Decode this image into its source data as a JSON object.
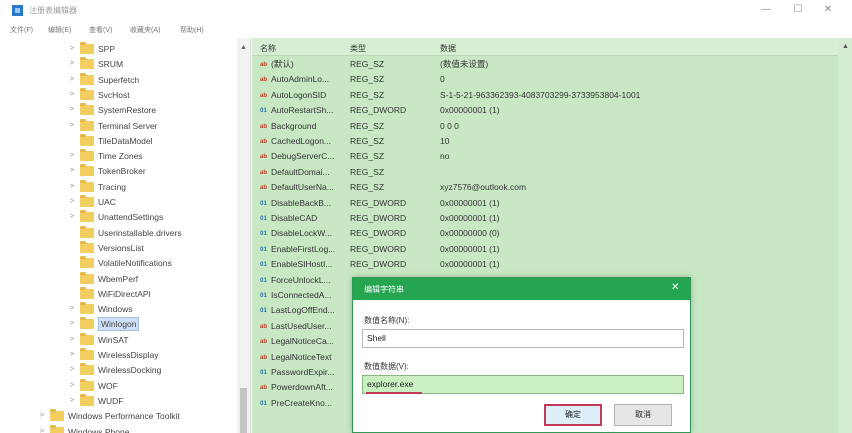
{
  "window": {
    "title": "注册表编辑器",
    "controls": {
      "minimize": "—",
      "maximize": "☐",
      "close": "✕"
    }
  },
  "menu": [
    "文件(F)",
    "编辑(E)",
    "查看(V)",
    "收藏夹(A)",
    "帮助(H)"
  ],
  "tree": {
    "items": [
      {
        "label": "SPP",
        "expandable": true
      },
      {
        "label": "SRUM",
        "expandable": true
      },
      {
        "label": "Superfetch",
        "expandable": true
      },
      {
        "label": "SvcHost",
        "expandable": true
      },
      {
        "label": "SystemRestore",
        "expandable": true
      },
      {
        "label": "Terminal Server",
        "expandable": true
      },
      {
        "label": "TileDataModel",
        "expandable": false
      },
      {
        "label": "Time Zones",
        "expandable": true
      },
      {
        "label": "TokenBroker",
        "expandable": true
      },
      {
        "label": "Tracing",
        "expandable": true
      },
      {
        "label": "UAC",
        "expandable": true
      },
      {
        "label": "UnattendSettings",
        "expandable": true
      },
      {
        "label": "Userinstallable.drivers",
        "expandable": false
      },
      {
        "label": "VersionsList",
        "expandable": false
      },
      {
        "label": "VolatileNotifications",
        "expandable": false
      },
      {
        "label": "WbemPerf",
        "expandable": false
      },
      {
        "label": "WiFiDirectAPI",
        "expandable": false
      },
      {
        "label": "Windows",
        "expandable": true
      },
      {
        "label": "Winlogon",
        "expandable": true,
        "selected": true
      },
      {
        "label": "WinSAT",
        "expandable": true
      },
      {
        "label": "WirelessDisplay",
        "expandable": true
      },
      {
        "label": "WirelessDocking",
        "expandable": true
      },
      {
        "label": "WOF",
        "expandable": true
      },
      {
        "label": "WUDF",
        "expandable": true
      },
      {
        "label": "Windows Performance Toolkit",
        "expandable": true
      },
      {
        "label": "Windows Phone",
        "expandable": true
      }
    ]
  },
  "list": {
    "headers": {
      "name": "名称",
      "type": "类型",
      "data": "数据"
    },
    "rows": [
      {
        "icon": "ab",
        "name": "(默认)",
        "type": "REG_SZ",
        "data": "(数值未设置)"
      },
      {
        "icon": "ab",
        "name": "AutoAdminLo...",
        "type": "REG_SZ",
        "data": "0"
      },
      {
        "icon": "ab",
        "name": "AutoLogonSID",
        "type": "REG_SZ",
        "data": "S-1-5-21-963362393-4083703299-3733953804-1001"
      },
      {
        "icon": "bin",
        "name": "AutoRestartSh...",
        "type": "REG_DWORD",
        "data": "0x00000001 (1)"
      },
      {
        "icon": "ab",
        "name": "Background",
        "type": "REG_SZ",
        "data": "0 0 0"
      },
      {
        "icon": "ab",
        "name": "CachedLogon...",
        "type": "REG_SZ",
        "data": "10"
      },
      {
        "icon": "ab",
        "name": "DebugServerC...",
        "type": "REG_SZ",
        "data": "no"
      },
      {
        "icon": "ab",
        "name": "DefaultDomai...",
        "type": "REG_SZ",
        "data": ""
      },
      {
        "icon": "ab",
        "name": "DefaultUserNa...",
        "type": "REG_SZ",
        "data": "xyz7576@outlook.com"
      },
      {
        "icon": "bin",
        "name": "DisableBackB...",
        "type": "REG_DWORD",
        "data": "0x00000001 (1)"
      },
      {
        "icon": "bin",
        "name": "DisableCAD",
        "type": "REG_DWORD",
        "data": "0x00000001 (1)"
      },
      {
        "icon": "bin",
        "name": "DisableLockW...",
        "type": "REG_DWORD",
        "data": "0x00000000 (0)"
      },
      {
        "icon": "bin",
        "name": "EnableFirstLog...",
        "type": "REG_DWORD",
        "data": "0x00000001 (1)"
      },
      {
        "icon": "bin",
        "name": "EnableSIHostI...",
        "type": "REG_DWORD",
        "data": "0x00000001 (1)"
      },
      {
        "icon": "bin",
        "name": "ForceUnlockL...",
        "type": "",
        "data": ""
      },
      {
        "icon": "bin",
        "name": "IsConnectedA...",
        "type": "",
        "data": ""
      },
      {
        "icon": "bin",
        "name": "LastLogOffEnd...",
        "type": "",
        "data": ""
      },
      {
        "icon": "ab",
        "name": "LastUsedUser...",
        "type": "",
        "data": ""
      },
      {
        "icon": "ab",
        "name": "LegalNoticeCa...",
        "type": "",
        "data": ""
      },
      {
        "icon": "ab",
        "name": "LegalNoticeText",
        "type": "",
        "data": ""
      },
      {
        "icon": "bin",
        "name": "PasswordExpir...",
        "type": "",
        "data": ""
      },
      {
        "icon": "ab",
        "name": "PowerdownAft...",
        "type": "",
        "data": ""
      },
      {
        "icon": "bin",
        "name": "PreCreateKno...",
        "type": "",
        "data": ""
      }
    ]
  },
  "dialog": {
    "title": "编辑字符串",
    "name_label": "数值名称(N):",
    "name_value": "Shell",
    "data_label": "数值数据(V):",
    "data_value": "explorer.exe",
    "ok_label": "确定",
    "cancel_label": "取消",
    "close": "✕"
  },
  "colors": {
    "list_background": "#c8e8c4",
    "dialog_title": "#25a550",
    "highlight_border": "#c23a5a"
  }
}
